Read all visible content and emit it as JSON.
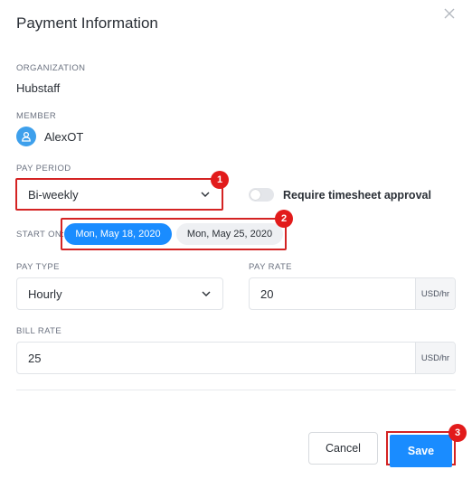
{
  "modal": {
    "title": "Payment Information"
  },
  "organization": {
    "label": "ORGANIZATION",
    "value": "Hubstaff"
  },
  "member": {
    "label": "MEMBER",
    "name": "AlexOT",
    "avatar_icon": "user-icon"
  },
  "pay_period": {
    "label": "PAY PERIOD",
    "selected": "Bi-weekly",
    "badge": "1"
  },
  "timesheet": {
    "label": "Require timesheet approval",
    "enabled": false
  },
  "start_on": {
    "label": "START ON:",
    "options": [
      "Mon, May 18, 2020",
      "Mon, May 25, 2020"
    ],
    "selected_index": 0,
    "badge": "2"
  },
  "pay_type": {
    "label": "PAY TYPE",
    "selected": "Hourly"
  },
  "pay_rate": {
    "label": "PAY RATE",
    "value": "20",
    "unit": "USD/hr"
  },
  "bill_rate": {
    "label": "BILL RATE",
    "value": "25",
    "unit": "USD/hr"
  },
  "actions": {
    "cancel_label": "Cancel",
    "save_label": "Save",
    "save_badge": "3"
  },
  "colors": {
    "accent": "#1a8cff",
    "highlight": "#d42323",
    "avatar": "#3ea0ec"
  }
}
